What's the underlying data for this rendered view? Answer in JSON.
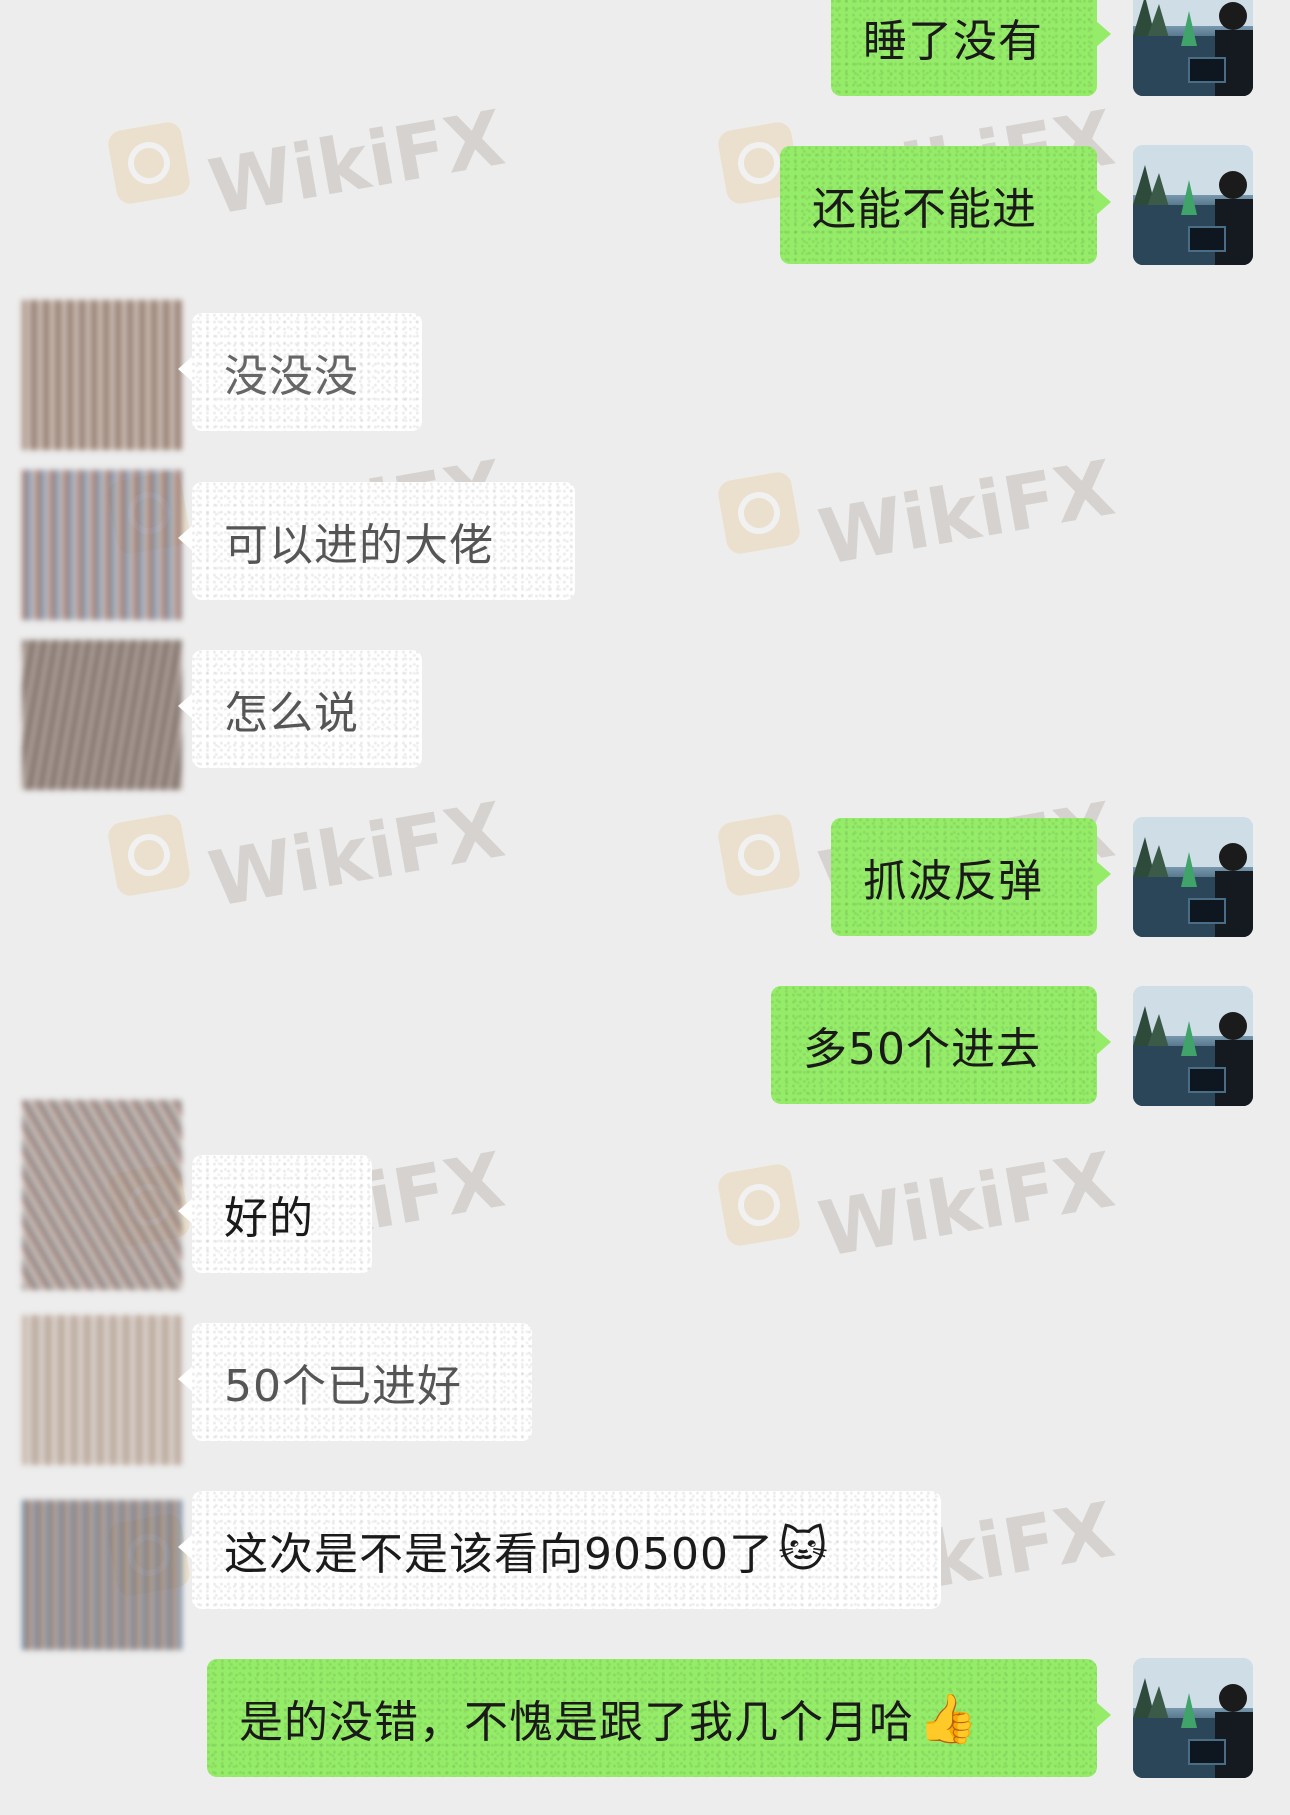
{
  "watermark": {
    "text": "WikiFX"
  },
  "messages": [
    {
      "from": "me",
      "text": "睡了没有"
    },
    {
      "from": "me",
      "text": "还能不能进"
    },
    {
      "from": "other",
      "text": "没没没"
    },
    {
      "from": "other",
      "text": "可以进的大佬"
    },
    {
      "from": "other",
      "text": "怎么说"
    },
    {
      "from": "me",
      "text": "抓波反弹"
    },
    {
      "from": "me",
      "text": "多50个进去"
    },
    {
      "from": "other",
      "text": "好的"
    },
    {
      "from": "other",
      "text": "50个已进好"
    },
    {
      "from": "other",
      "text": "这次是不是该看向90500了",
      "emoji": "🐱"
    },
    {
      "from": "me",
      "text": "是的没错，不愧是跟了我几个月哈",
      "emoji": "👍"
    }
  ],
  "colors": {
    "background": "#ededed",
    "my_bubble": "#95ec69",
    "other_bubble": "#ffffff",
    "watermark_logo": "#e2b35f"
  }
}
